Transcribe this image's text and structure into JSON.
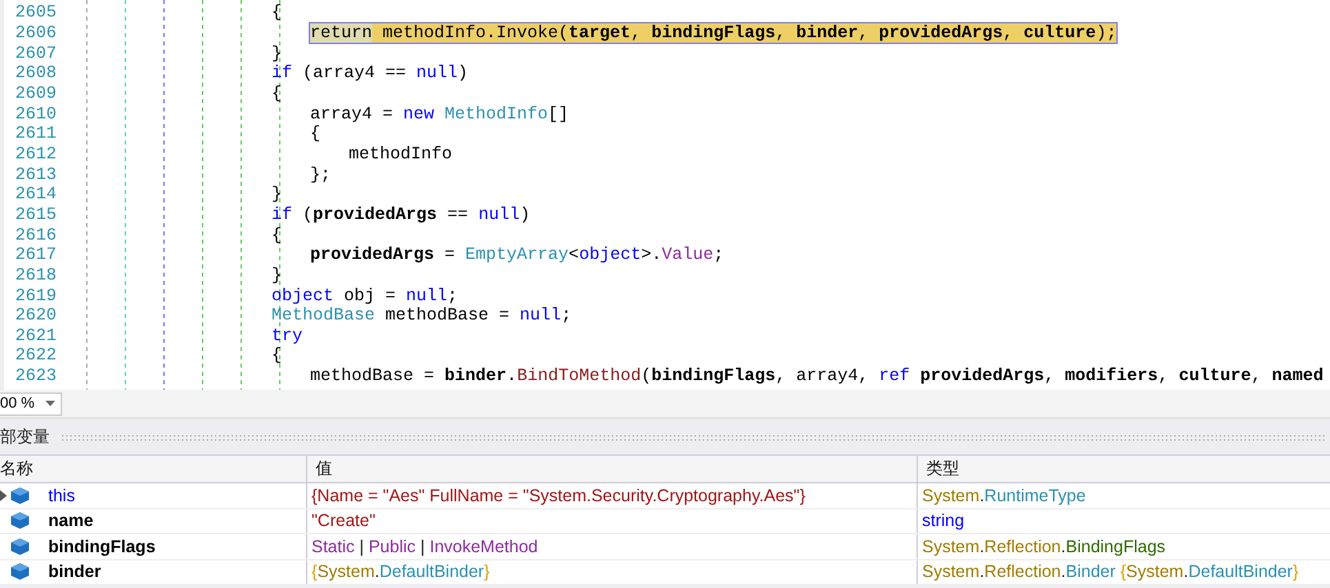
{
  "editor": {
    "lines": [
      {
        "number": "2605",
        "current": false,
        "tokens": [
          {
            "kind": "plain",
            "text": "{"
          }
        ],
        "children": [
          {
            "number": "2606",
            "current": true,
            "tokens": [
              {
                "kind": "keyword",
                "text": "return"
              },
              {
                "kind": "plain",
                "text": " methodInfo.Invoke("
              },
              {
                "kind": "bold",
                "text": "target"
              },
              {
                "kind": "plain",
                "text": ", "
              },
              {
                "kind": "bold",
                "text": "bindingFlags"
              },
              {
                "kind": "plain",
                "text": ", "
              },
              {
                "kind": "bold",
                "text": "binder"
              },
              {
                "kind": "plain",
                "text": ", "
              },
              {
                "kind": "bold",
                "text": "providedArgs"
              },
              {
                "kind": "plain",
                "text": ", "
              },
              {
                "kind": "bold",
                "text": "culture"
              },
              {
                "kind": "plain",
                "text": ");"
              }
            ]
          }
        ]
      },
      {
        "number": "2607",
        "current": false,
        "tokens": [
          {
            "kind": "plain",
            "text": "}"
          }
        ]
      },
      {
        "number": "2608",
        "current": false,
        "tokens": [
          {
            "kind": "keyword",
            "text": "if"
          },
          {
            "kind": "plain",
            "text": " (array4 == "
          },
          {
            "kind": "keyword",
            "text": "null"
          },
          {
            "kind": "plain",
            "text": ")"
          }
        ]
      },
      {
        "number": "2609",
        "current": false,
        "tokens": [
          {
            "kind": "plain",
            "text": "{"
          }
        ],
        "children": [
          {
            "number": "2610",
            "current": false,
            "tokens": [
              {
                "kind": "plain",
                "text": "array4 = "
              },
              {
                "kind": "keyword",
                "text": "new "
              },
              {
                "kind": "type",
                "text": "MethodInfo"
              },
              {
                "kind": "plain",
                "text": "[]"
              }
            ]
          },
          {
            "number": "2611",
            "current": false,
            "tokens": [
              {
                "kind": "plain",
                "text": "{"
              }
            ],
            "children": [
              {
                "number": "2612",
                "current": false,
                "tokens": [
                  {
                    "kind": "plain",
                    "text": "methodInfo"
                  }
                ]
              }
            ]
          },
          {
            "number": "2613",
            "current": false,
            "tokens": [
              {
                "kind": "plain",
                "text": "};"
              }
            ]
          }
        ]
      },
      {
        "number": "2614",
        "current": false,
        "tokens": [
          {
            "kind": "plain",
            "text": "}"
          }
        ]
      },
      {
        "number": "2615",
        "current": false,
        "tokens": [
          {
            "kind": "keyword",
            "text": "if"
          },
          {
            "kind": "plain",
            "text": " ("
          },
          {
            "kind": "bold",
            "text": "providedArgs"
          },
          {
            "kind": "plain",
            "text": " == "
          },
          {
            "kind": "keyword",
            "text": "null"
          },
          {
            "kind": "plain",
            "text": ")"
          }
        ]
      },
      {
        "number": "2616",
        "current": false,
        "tokens": [
          {
            "kind": "plain",
            "text": "{"
          }
        ],
        "children": [
          {
            "number": "2617",
            "current": false,
            "tokens": [
              {
                "kind": "bold",
                "text": "providedArgs"
              },
              {
                "kind": "plain",
                "text": " = "
              },
              {
                "kind": "type",
                "text": "EmptyArray"
              },
              {
                "kind": "plain",
                "text": "<"
              },
              {
                "kind": "keyword",
                "text": "object"
              },
              {
                "kind": "plain",
                "text": ">."
              },
              {
                "kind": "property",
                "text": "Value"
              },
              {
                "kind": "plain",
                "text": ";"
              }
            ]
          }
        ]
      },
      {
        "number": "2618",
        "current": false,
        "tokens": [
          {
            "kind": "plain",
            "text": "}"
          }
        ]
      },
      {
        "number": "2619",
        "current": false,
        "tokens": [
          {
            "kind": "keyword",
            "text": "object"
          },
          {
            "kind": "plain",
            "text": " obj = "
          },
          {
            "kind": "keyword",
            "text": "null"
          },
          {
            "kind": "plain",
            "text": ";"
          }
        ]
      },
      {
        "number": "2620",
        "current": false,
        "tokens": [
          {
            "kind": "type",
            "text": "MethodBase"
          },
          {
            "kind": "plain",
            "text": " methodBase = "
          },
          {
            "kind": "keyword",
            "text": "null"
          },
          {
            "kind": "plain",
            "text": ";"
          }
        ]
      },
      {
        "number": "2621",
        "current": false,
        "tokens": [
          {
            "kind": "keyword",
            "text": "try"
          }
        ]
      },
      {
        "number": "2622",
        "current": false,
        "tokens": [
          {
            "kind": "plain",
            "text": "{"
          }
        ],
        "children": [
          {
            "number": "2623",
            "current": false,
            "tokens": [
              {
                "kind": "plain",
                "text": "methodBase = "
              },
              {
                "kind": "bold",
                "text": "binder"
              },
              {
                "kind": "plain",
                "text": "."
              },
              {
                "kind": "method",
                "text": "BindToMethod"
              },
              {
                "kind": "plain",
                "text": "("
              },
              {
                "kind": "bold",
                "text": "bindingFlags"
              },
              {
                "kind": "plain",
                "text": ", array4, "
              },
              {
                "kind": "keyword",
                "text": "ref "
              },
              {
                "kind": "bold",
                "text": "providedArgs"
              },
              {
                "kind": "plain",
                "text": ", "
              },
              {
                "kind": "bold",
                "text": "modifiers"
              },
              {
                "kind": "plain",
                "text": ", "
              },
              {
                "kind": "bold",
                "text": "culture"
              },
              {
                "kind": "plain",
                "text": ", "
              },
              {
                "kind": "bold",
                "text": "named"
              }
            ]
          }
        ]
      }
    ]
  },
  "zoom": {
    "value": "00 %"
  },
  "locals": {
    "title": "部变量",
    "columns": [
      "名称",
      "值",
      "类型"
    ],
    "rows": [
      {
        "name": "this",
        "kind": "keyword",
        "expandable": true,
        "value": [
          {
            "kind": "string",
            "text": "{Name = \"Aes\" FullName = \"System.Security.Cryptography.Aes\"}"
          }
        ],
        "type": [
          {
            "kind": "ns",
            "text": "System"
          },
          {
            "kind": "plain",
            "text": "."
          },
          {
            "kind": "type",
            "text": "RuntimeType"
          }
        ]
      },
      {
        "name": "name",
        "kind": "variable",
        "expandable": false,
        "value": [
          {
            "kind": "string",
            "text": "\"Create\""
          }
        ],
        "type": [
          {
            "kind": "keyword",
            "text": "string"
          }
        ]
      },
      {
        "name": "bindingFlags",
        "kind": "variable",
        "expandable": false,
        "value": [
          {
            "kind": "enum",
            "text": "Static"
          },
          {
            "kind": "plain",
            "text": " | "
          },
          {
            "kind": "enum",
            "text": "Public"
          },
          {
            "kind": "plain",
            "text": " | "
          },
          {
            "kind": "enum",
            "text": "InvokeMethod"
          }
        ],
        "type": [
          {
            "kind": "ns",
            "text": "System"
          },
          {
            "kind": "plain",
            "text": "."
          },
          {
            "kind": "ns",
            "text": "Reflection"
          },
          {
            "kind": "plain",
            "text": "."
          },
          {
            "kind": "enumtype",
            "text": "BindingFlags"
          }
        ]
      },
      {
        "name": "binder",
        "kind": "variable",
        "expandable": false,
        "value": [
          {
            "kind": "brace",
            "text": "{"
          },
          {
            "kind": "ns",
            "text": "System"
          },
          {
            "kind": "plain",
            "text": "."
          },
          {
            "kind": "type",
            "text": "DefaultBinder"
          },
          {
            "kind": "brace",
            "text": "}"
          }
        ],
        "type": [
          {
            "kind": "ns",
            "text": "System"
          },
          {
            "kind": "plain",
            "text": "."
          },
          {
            "kind": "ns",
            "text": "Reflection"
          },
          {
            "kind": "plain",
            "text": "."
          },
          {
            "kind": "type",
            "text": "Binder "
          },
          {
            "kind": "brace",
            "text": "{"
          },
          {
            "kind": "ns",
            "text": "System"
          },
          {
            "kind": "plain",
            "text": "."
          },
          {
            "kind": "type",
            "text": "DefaultBinder"
          },
          {
            "kind": "brace",
            "text": "}"
          }
        ]
      }
    ]
  }
}
